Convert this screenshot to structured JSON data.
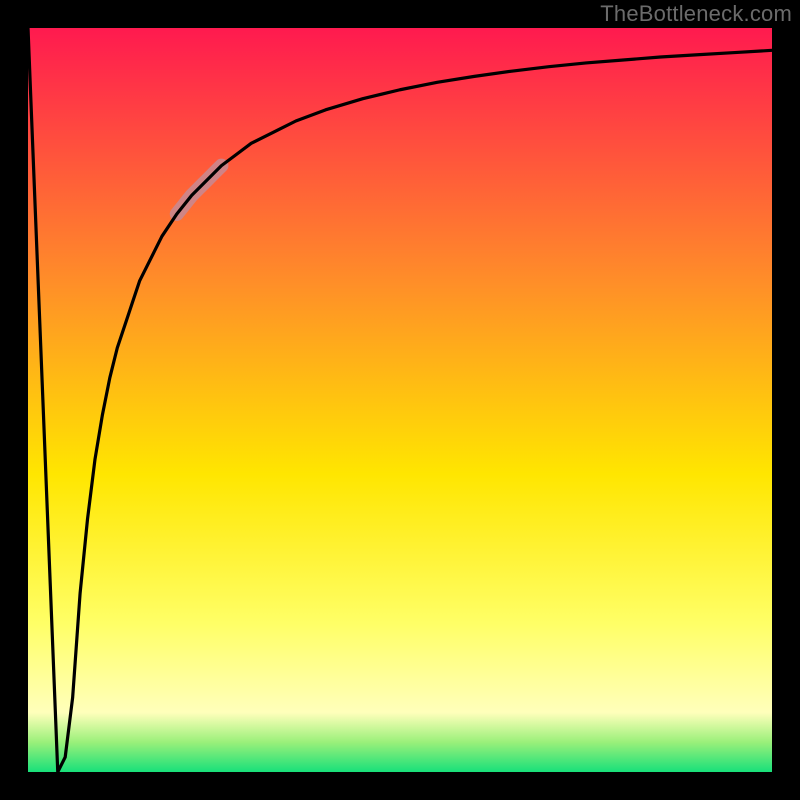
{
  "attribution": "TheBottleneck.com",
  "chart_data": {
    "type": "line",
    "title": "",
    "xlabel": "",
    "ylabel": "",
    "xlim": [
      0,
      100
    ],
    "ylim": [
      0,
      100
    ],
    "x": [
      0,
      1,
      2,
      3,
      4,
      5,
      6,
      7,
      8,
      9,
      10,
      11,
      12,
      13,
      14,
      15,
      16,
      17,
      18,
      20,
      22,
      24,
      26,
      28,
      30,
      33,
      36,
      40,
      45,
      50,
      55,
      60,
      65,
      70,
      75,
      80,
      85,
      90,
      95,
      100
    ],
    "values": [
      100,
      75,
      50,
      25,
      0,
      2,
      10,
      24,
      34,
      42,
      48,
      53,
      57,
      60,
      63,
      66,
      68,
      70,
      72,
      75,
      77.5,
      79.5,
      81.5,
      83,
      84.5,
      86,
      87.5,
      89,
      90.5,
      91.7,
      92.7,
      93.5,
      94.2,
      94.8,
      95.3,
      95.7,
      96.1,
      96.4,
      96.7,
      97
    ],
    "highlight_segment": {
      "x_start": 20,
      "x_end": 26,
      "color": "#c78a94",
      "width": 14
    },
    "background_gradient": {
      "type": "vertical",
      "stops": [
        {
          "offset": 0.0,
          "color": "#ff1a4f"
        },
        {
          "offset": 0.33,
          "color": "#ff8a2a"
        },
        {
          "offset": 0.6,
          "color": "#ffe600"
        },
        {
          "offset": 0.8,
          "color": "#ffff66"
        },
        {
          "offset": 0.92,
          "color": "#ffffbb"
        },
        {
          "offset": 0.96,
          "color": "#9af07a"
        },
        {
          "offset": 1.0,
          "color": "#18e07a"
        }
      ]
    }
  }
}
